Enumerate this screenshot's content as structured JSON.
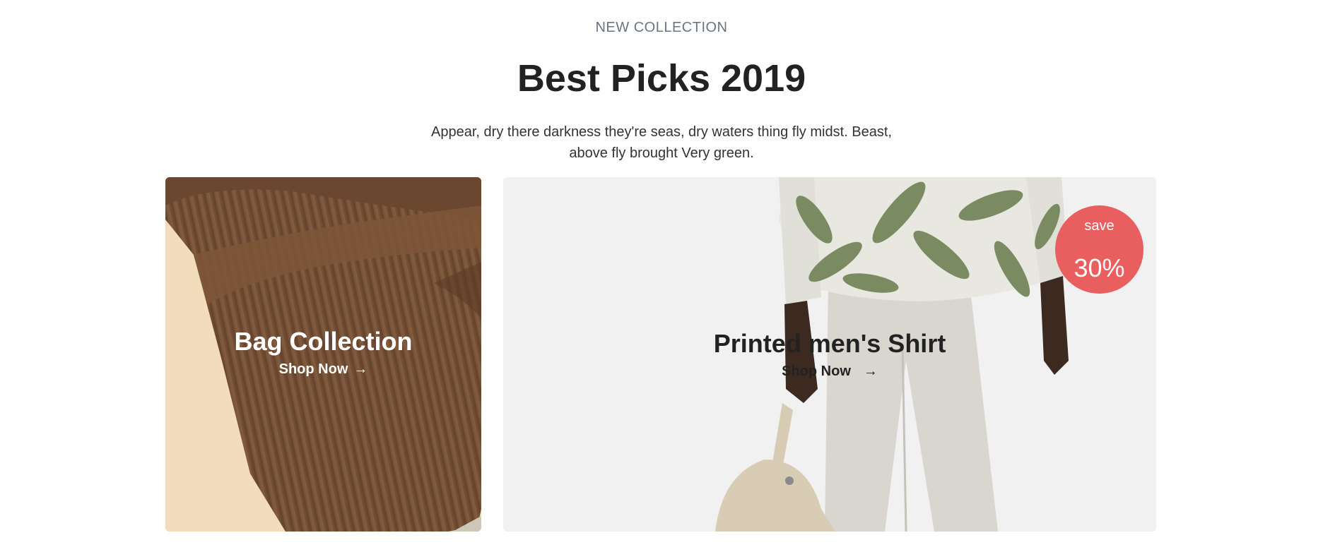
{
  "header": {
    "eyebrow": "NEW COLLECTION",
    "title": "Best Picks 2019",
    "subtitle": "Appear, dry there darkness they're seas, dry waters thing fly midst. Beast, above fly brought Very green."
  },
  "cards": [
    {
      "title": "Bag Collection",
      "link_label": "Shop Now",
      "link_icon": "arrow-right-icon",
      "image": "brown-knit-sweater-closeup"
    },
    {
      "title": "Printed men's Shirt",
      "link_label": "Shop Now",
      "link_icon": "arrow-right-icon",
      "image": "man-in-leaf-print-shirt-with-bag",
      "badge": {
        "label": "save",
        "value": "30%"
      }
    }
  ],
  "colors": {
    "badge": "#e95f5f",
    "eyebrow": "#6c7480",
    "heading": "#222222",
    "card_right_bg": "#f1f1f1",
    "card_left_bg": "#f3dcbc"
  }
}
